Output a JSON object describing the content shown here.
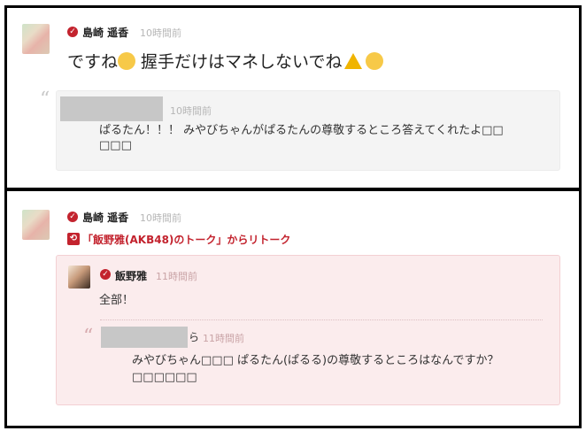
{
  "post1": {
    "author": "島崎 遥香",
    "time": "10時間前",
    "message_before": "ですね",
    "message_middle": " 握手だけはマネしないでね",
    "quote": {
      "time": "10時間前",
      "line1": "ぱるたん！！！ みやびちゃんがぱるたんの尊敬するところ答えてくれたよ□□",
      "line2": "□□□"
    }
  },
  "post2": {
    "author": "島崎 遥香",
    "time": "10時間前",
    "retalk_label": "「飯野雅(AKB48)のトーク」からリトーク",
    "retalk": {
      "author": "飯野雅",
      "time": "11時間前",
      "message": "全部！",
      "nested": {
        "name_tail": "ら",
        "time": "11時間前",
        "line1": "みやびちゃん□□□ ぱるたん(ぱるる)の尊敬するところはなんですか？",
        "line2": "□□□□□□"
      }
    }
  },
  "icons": {
    "verified": "verified-badge-icon",
    "quote": "quote-mark-icon",
    "retalk": "retalk-icon",
    "emoji1": "grinning-face-emoji",
    "emoji2": "warning-emoji",
    "emoji3": "laughing-tears-emoji"
  },
  "colors": {
    "brand_red": "#c3232e",
    "quote_bg": "#f4f4f4",
    "retalk_bg": "#fbeced"
  }
}
